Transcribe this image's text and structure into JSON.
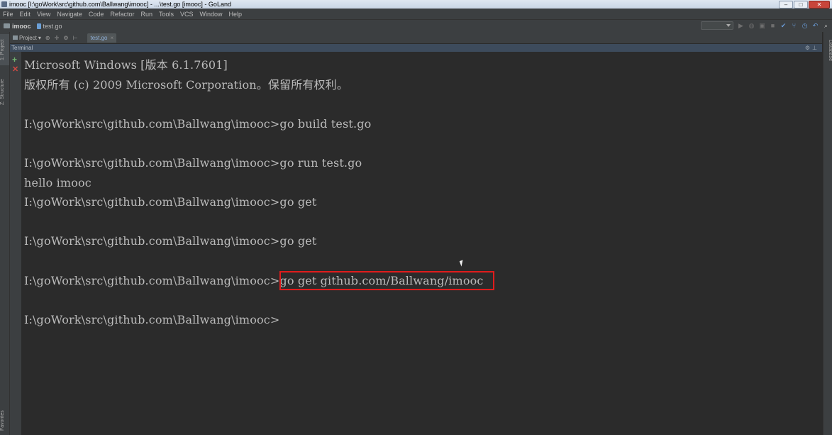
{
  "window": {
    "title": "imooc [I:\\goWork\\src\\github.com\\Ballwang\\imooc] - ...\\test.go [imooc] - GoLand",
    "controls": [
      "–",
      "□",
      "✕"
    ]
  },
  "menu": [
    "File",
    "Edit",
    "View",
    "Navigate",
    "Code",
    "Refactor",
    "Run",
    "Tools",
    "VCS",
    "Window",
    "Help"
  ],
  "nav": {
    "project": "imooc",
    "file": "test.go"
  },
  "project_panel": {
    "label": "Project",
    "tab_label": "1: Project"
  },
  "editor_tab": {
    "label": "test.go",
    "close": "×"
  },
  "terminal": {
    "header": "Terminal",
    "lines": [
      "Microsoft Windows [版本 6.1.7601]",
      "版权所有 (c) 2009 Microsoft Corporation。保留所有权利。",
      "",
      "I:\\goWork\\src\\github.com\\Ballwang\\imooc>go build test.go",
      "",
      "I:\\goWork\\src\\github.com\\Ballwang\\imooc>go run test.go",
      "hello imooc",
      "I:\\goWork\\src\\github.com\\Ballwang\\imooc>go get",
      "",
      "I:\\goWork\\src\\github.com\\Ballwang\\imooc>go get",
      "",
      "I:\\goWork\\src\\github.com\\Ballwang\\imooc>go get github.com/Ballwang/imooc",
      "",
      "I:\\goWork\\src\\github.com\\Ballwang\\imooc>"
    ]
  },
  "side_tabs": {
    "structure": "Z: Structure",
    "favorites": "Favorites",
    "database": "Database"
  },
  "colors": {
    "background": "#2b2b2b",
    "highlight_box": "#e01c1c",
    "text": "#bbbbbb"
  }
}
